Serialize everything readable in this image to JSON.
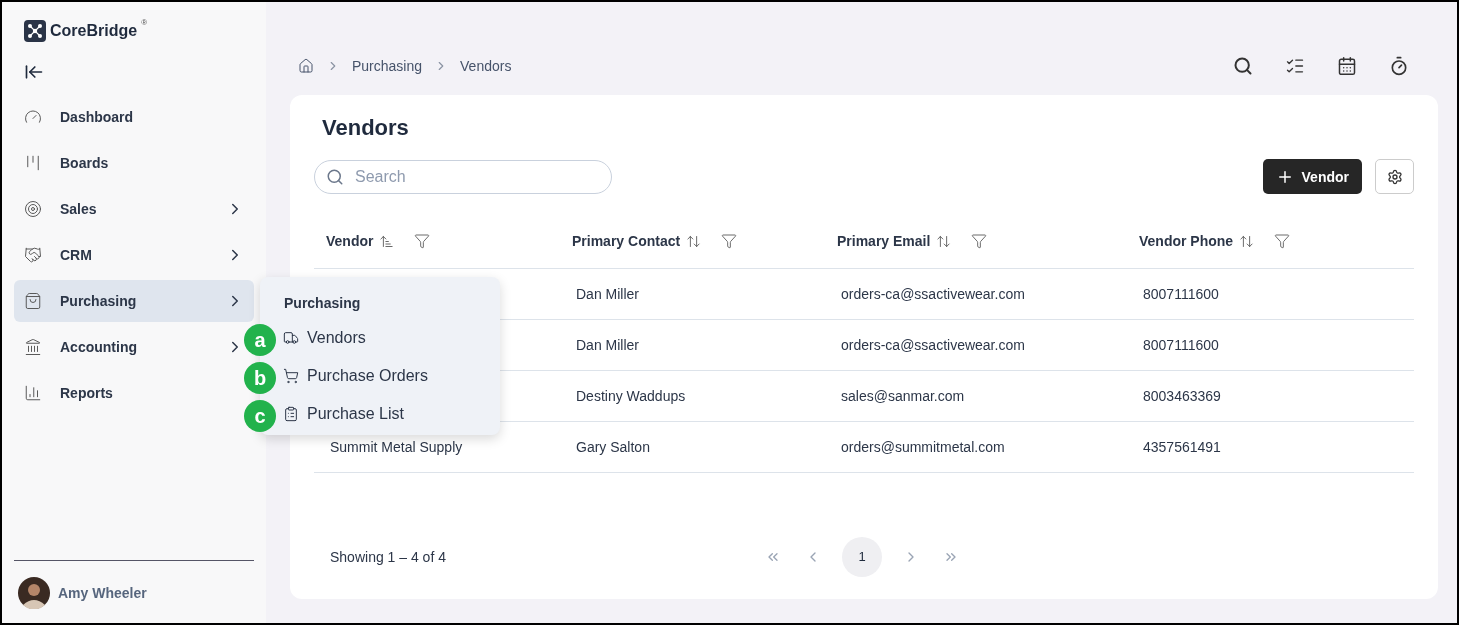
{
  "brand": {
    "name": "CoreBridge",
    "mark": "®"
  },
  "sidebar": {
    "items": [
      {
        "label": "Dashboard",
        "has_children": false,
        "selected": false
      },
      {
        "label": "Boards",
        "has_children": false,
        "selected": false
      },
      {
        "label": "Sales",
        "has_children": true,
        "selected": false
      },
      {
        "label": "CRM",
        "has_children": true,
        "selected": false
      },
      {
        "label": "Purchasing",
        "has_children": true,
        "selected": true
      },
      {
        "label": "Accounting",
        "has_children": true,
        "selected": false
      },
      {
        "label": "Reports",
        "has_children": false,
        "selected": false
      }
    ],
    "user": {
      "name": "Amy Wheeler"
    }
  },
  "flyout": {
    "title": "Purchasing",
    "items": [
      {
        "label": "Vendors",
        "badge": "a"
      },
      {
        "label": "Purchase Orders",
        "badge": "b"
      },
      {
        "label": "Purchase List",
        "badge": "c"
      }
    ]
  },
  "breadcrumb": [
    "Purchasing",
    "Vendors"
  ],
  "page": {
    "title": "Vendors",
    "search": {
      "placeholder": "Search"
    },
    "add_button": "Vendor"
  },
  "table": {
    "columns": [
      {
        "label": "Vendor",
        "sorted": true
      },
      {
        "label": "Primary Contact",
        "sorted": false
      },
      {
        "label": "Primary Email",
        "sorted": false
      },
      {
        "label": "Vendor Phone",
        "sorted": false
      }
    ],
    "rows": [
      {
        "contact": "Dan Miller",
        "email": "orders-ca@ssactivewear.com",
        "phone": "8007111600"
      },
      {
        "contact": "Dan Miller",
        "email": "orders-ca@ssactivewear.com",
        "phone": "8007111600"
      },
      {
        "contact": "Destiny Waddups",
        "email": "sales@sanmar.com",
        "phone": "8003463369"
      },
      {
        "vendor": "Summit Metal Supply",
        "contact": "Gary Salton",
        "email": "orders@summitmetal.com",
        "phone": "4357561491"
      }
    ]
  },
  "pagination": {
    "summary": "Showing 1 – 4 of 4",
    "pages": [
      {
        "label": "1",
        "selected": true
      }
    ]
  }
}
